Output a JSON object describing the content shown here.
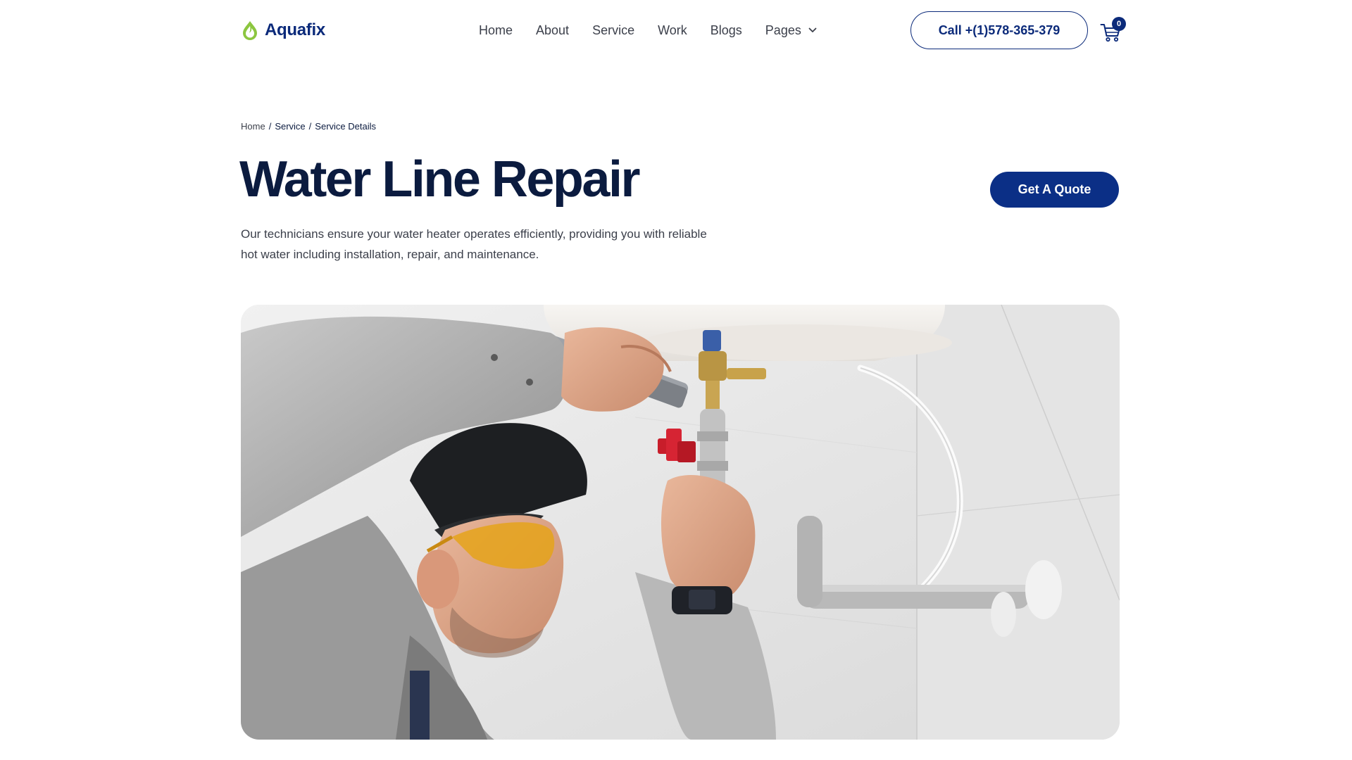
{
  "header": {
    "logo_text": "Aquafix",
    "nav": [
      {
        "label": "Home"
      },
      {
        "label": "About"
      },
      {
        "label": "Service"
      },
      {
        "label": "Work"
      },
      {
        "label": "Blogs"
      },
      {
        "label": "Pages"
      }
    ],
    "call_label": "Call +(1)578-365-379",
    "cart_count": "0"
  },
  "breadcrumb": {
    "items": [
      "Home",
      "Service",
      "Service Details"
    ],
    "separator": "/"
  },
  "hero": {
    "title": "Water Line Repair",
    "quote_label": "Get A Quote",
    "intro": "Our technicians ensure your water heater operates efficiently, providing you with reliable hot water including installation, repair, and maintenance."
  },
  "colors": {
    "brand_navy": "#0b2a7a",
    "heading": "#0b1b3f",
    "logo_green": "#8cc63f",
    "body_text": "#3b3f4a"
  },
  "icons": {
    "logo": "water-drop-logo-icon",
    "dropdown": "chevron-down-icon",
    "cart": "shopping-cart-icon"
  },
  "image": {
    "subject": "plumber-repairing-water-heater-pipe"
  }
}
